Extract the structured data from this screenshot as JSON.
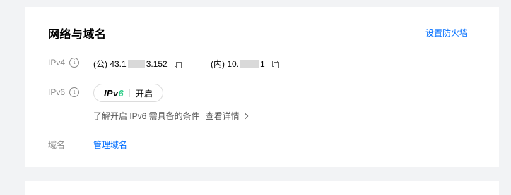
{
  "section": {
    "title": "网络与域名",
    "firewall_link": "设置防火墙"
  },
  "ipv4": {
    "label": "IPv4",
    "public_prefix": "(公) 43.1",
    "public_suffix": "3.152",
    "private_prefix": "(内) 10.",
    "private_suffix": "1"
  },
  "ipv6": {
    "label": "IPv6",
    "logo_text": "IPv",
    "logo_six": "6",
    "enable_label": "开启",
    "hint": "了解开启 IPv6 需具备的条件",
    "details_link": "查看详情"
  },
  "domain": {
    "label": "域名",
    "manage_link": "管理域名"
  },
  "colors": {
    "link": "#006eff",
    "ipv6_accent": "#29cc85",
    "muted_label": "#888888",
    "masked": "#d9d9d9"
  },
  "icons": {
    "info": "info-circle-icon",
    "copy": "copy-icon",
    "chevron": "chevron-right-icon"
  }
}
